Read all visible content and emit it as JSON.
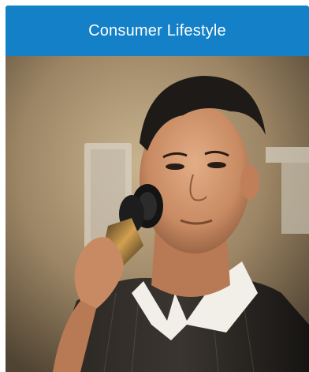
{
  "card": {
    "title": "Consumer Lifestyle",
    "header_color": "#1480c8",
    "image": {
      "icon": "man-shaving-photo",
      "subject": "man-with-electric-shaver"
    }
  }
}
